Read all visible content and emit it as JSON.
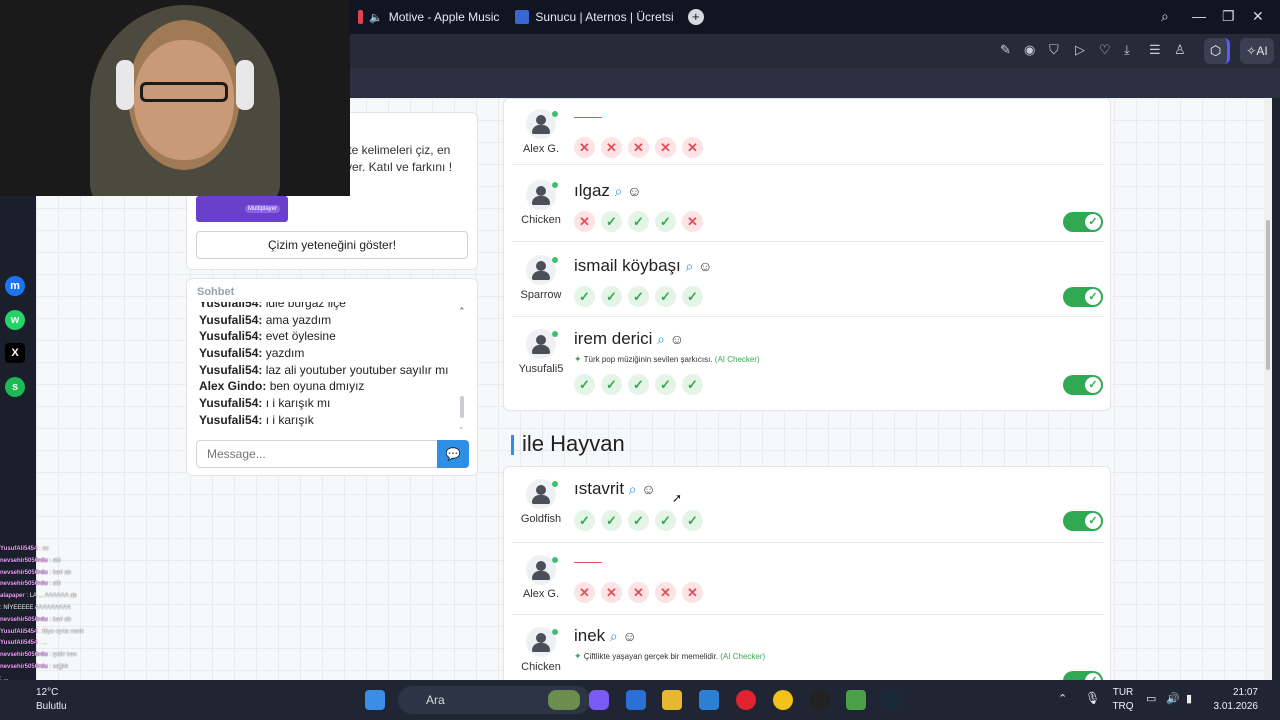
{
  "browser": {
    "tabs": [
      {
        "label": "Motive - Apple Music",
        "color": "#e0434f"
      },
      {
        "label": "Sunucu | Aternos | Ücretsi",
        "color": "#3a66d1"
      }
    ],
    "ai_label": "AI"
  },
  "promo": {
    "text": "'te kelimeleri çiz, en ver. Katıl ve farkını !",
    "badge": "Multiplayer",
    "draw_button": "Çizim yeteneğini göster!"
  },
  "chat": {
    "title": "Sohbet",
    "messages": [
      {
        "user": "Yusufali54:",
        "text": "idle burgaz ilçe"
      },
      {
        "user": "Yusufali54:",
        "text": "ama yazdım"
      },
      {
        "user": "Yusufali54:",
        "text": "evet öylesine"
      },
      {
        "user": "Yusufali54:",
        "text": "yazdım"
      },
      {
        "user": "Yusufali54:",
        "text": "laz ali youtuber youtuber sayılır mı"
      },
      {
        "user": "Alex Gindo:",
        "text": "ben oyuna dmıyız"
      },
      {
        "user": "Yusufali54:",
        "text": "ı i karışık mı"
      },
      {
        "user": "Yusufali54:",
        "text": "ı i karışık"
      }
    ],
    "placeholder": "Message..."
  },
  "section1": {
    "rows": [
      {
        "player": "Alex G.",
        "word": "",
        "votes": [
          "no",
          "no",
          "no",
          "no",
          "no"
        ],
        "toggle": false,
        "hint": ""
      },
      {
        "player": "Chicken",
        "word": "ılgaz",
        "votes": [
          "no",
          "yes",
          "yes",
          "yes",
          "no"
        ],
        "toggle": true,
        "hint": ""
      },
      {
        "player": "Sparrow",
        "word": "ismail köybaşı",
        "votes": [
          "yes",
          "yes",
          "yes",
          "yes",
          "yes"
        ],
        "toggle": true,
        "hint": ""
      },
      {
        "player": "Yusufali5",
        "word": "irem derici",
        "votes": [
          "yes",
          "yes",
          "yes",
          "yes",
          "yes"
        ],
        "toggle": true,
        "hint": "Türk pop müziğinin sevilen şarkıcısı.",
        "hint_tag": "(AI Checker)"
      }
    ]
  },
  "section2": {
    "title": "ile Hayvan",
    "rows": [
      {
        "player": "Goldfish",
        "word": "ıstavrit",
        "votes": [
          "yes",
          "yes",
          "yes",
          "yes",
          "yes"
        ],
        "toggle": true,
        "hint": ""
      },
      {
        "player": "Alex G.",
        "word": "",
        "votes": [
          "no",
          "no",
          "no",
          "no",
          "no"
        ],
        "toggle": false,
        "hint": ""
      },
      {
        "player": "Chicken",
        "word": "inek",
        "votes": [],
        "toggle": true,
        "hint": "Çiftlikte yaşayan gerçek bir memelidir.",
        "hint_tag": "(AI Checker)"
      }
    ]
  },
  "stream_chat": [
    {
      "user": "YusufAli5454",
      "text": "as"
    },
    {
      "user": "nevsehir5050rdu",
      "text": "abi"
    },
    {
      "user": "nevsehir5050rdu",
      "text": "bari ab"
    },
    {
      "user": "nevsehir5050rdu",
      "text": "abi"
    },
    {
      "user": "alapaper",
      "text": "LA ... AAAAAA ab"
    },
    {
      "user": "",
      "text": "NİYEEEEE AAAAAAAAA"
    },
    {
      "user": "nevsehir5050rdu",
      "text": "bari ab"
    },
    {
      "user": "YusufAli5454",
      "text": "Biyo oyna vardı"
    },
    {
      "user": "YusufAli5454",
      "text": "..."
    },
    {
      "user": "nevsehir5050rdu",
      "text": "iyidir ben"
    },
    {
      "user": "nevsehir5050rdu",
      "text": "sağlık"
    },
    {
      "user": "",
      "text": "..."
    }
  ],
  "taskbar": {
    "weather_temp": "12°C",
    "weather_desc": "Bulutlu",
    "search": "Ara",
    "lang1": "TUR",
    "lang2": "TRQ",
    "time": "21:07",
    "date": "3.01.2026"
  }
}
